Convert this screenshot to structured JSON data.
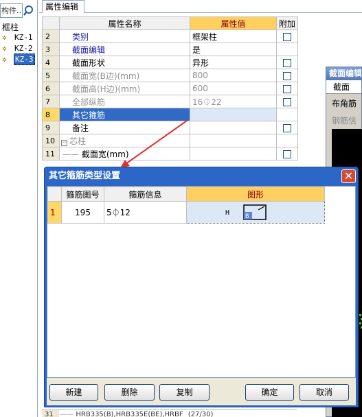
{
  "component_tree": {
    "search_text": "构件..",
    "title": "框柱",
    "items": [
      {
        "label": "KZ-1",
        "selected": false
      },
      {
        "label": "KZ-2",
        "selected": false
      },
      {
        "label": "KZ-3",
        "selected": true
      }
    ]
  },
  "property_editor": {
    "tab_label": "属性编辑",
    "headers": {
      "name": "属性名称",
      "value": "属性值",
      "extra": "附加"
    },
    "rows": [
      {
        "num": "2",
        "name": "类别",
        "value": "框架柱",
        "style": "blue",
        "checkbox": true
      },
      {
        "num": "3",
        "name": "截面编辑",
        "value": "是",
        "style": "blue",
        "checkbox": false
      },
      {
        "num": "4",
        "name": "截面形状",
        "value": "异形",
        "style": "normal",
        "checkbox": true
      },
      {
        "num": "5",
        "name": "截面宽(B边)(mm)",
        "value": "800",
        "style": "gray",
        "checkbox": true
      },
      {
        "num": "6",
        "name": "截面高(H边)(mm)",
        "value": "600",
        "style": "gray",
        "checkbox": true
      },
      {
        "num": "7",
        "name": "全部纵筋",
        "value": "16⏀22",
        "style": "gray",
        "checkbox": true
      },
      {
        "num": "8",
        "name": "其它箍筋",
        "value": "",
        "style": "selected",
        "checkbox": false
      },
      {
        "num": "9",
        "name": "备注",
        "value": "",
        "style": "normal",
        "checkbox": true
      },
      {
        "num": "10",
        "name": "芯柱",
        "value": "",
        "style": "group",
        "checkbox": false
      },
      {
        "num": "11",
        "name": "截面宽(mm)",
        "value": "",
        "style": "child",
        "checkbox": true
      }
    ],
    "bottom_peek": {
      "num": "31",
      "text": "HRB335(B),HRB335E(BE),HRBF",
      "value": "(27/30)"
    }
  },
  "section_editor": {
    "title": "截面编辑",
    "tab_label": "截面",
    "buttons": [
      "布角筋",
      "钢筋信"
    ]
  },
  "dialog": {
    "title": "其它箍筋类型设置",
    "close_label": "✕",
    "headers": {
      "shape_no": "箍筋图号",
      "info": "箍筋信息",
      "shape": "图形"
    },
    "rows": [
      {
        "num": "1",
        "shape_no": "195",
        "info": "5⏀12",
        "shape_h_label": "H",
        "shape_b_label": "B"
      }
    ],
    "buttons": {
      "new": "新建",
      "delete": "删除",
      "copy": "复制",
      "ok": "确定",
      "cancel": "取消"
    }
  },
  "colors": {
    "title_bar": "#2c67c8",
    "header_highlight": "#ffd060",
    "selection": "#316ac5",
    "arrow": "#e03030"
  }
}
